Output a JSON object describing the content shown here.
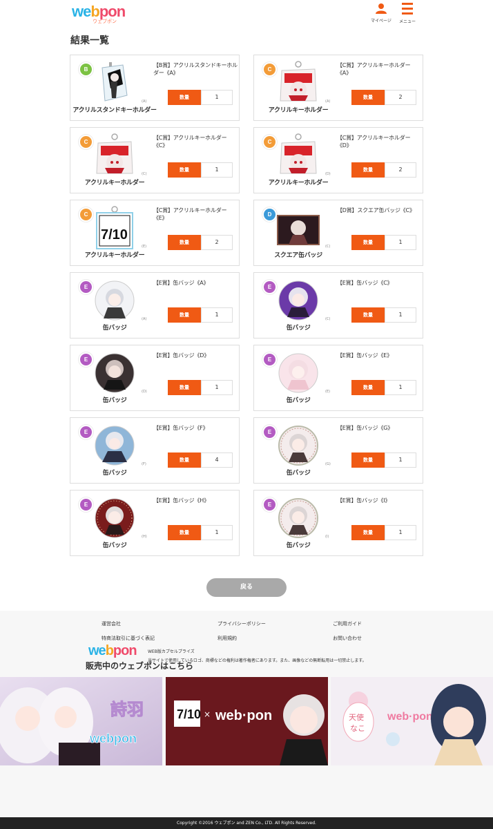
{
  "header": {
    "logo_text": "webpon",
    "logo_kana": "ウェブポン",
    "mypage_label": "マイページ",
    "menu_label": "メニュー"
  },
  "page_title": "結果一覧",
  "qty_label": "数量",
  "items": [
    {
      "rank": "B",
      "rank_color": "#7cc243",
      "type": "acrylic-stand",
      "thumb_label": "アクリルスタンドキーホルダー",
      "variant": "(A)",
      "title": "【B賞】アクリルスタンドキーホルダー《A》",
      "qty": "1"
    },
    {
      "rank": "C",
      "rank_color": "#f39c38",
      "type": "acrylic-key",
      "thumb_label": "アクリルキーホルダー",
      "variant": "(A)",
      "title": "【C賞】アクリルキーホルダー《A》",
      "qty": "2"
    },
    {
      "rank": "C",
      "rank_color": "#f39c38",
      "type": "acrylic-key",
      "thumb_label": "アクリルキーホルダー",
      "variant": "(C)",
      "title": "【C賞】アクリルキーホルダー《C》",
      "qty": "1"
    },
    {
      "rank": "C",
      "rank_color": "#f39c38",
      "type": "acrylic-key",
      "thumb_label": "アクリルキーホルダー",
      "variant": "(D)",
      "title": "【C賞】アクリルキーホルダー《D》",
      "qty": "2"
    },
    {
      "rank": "C",
      "rank_color": "#f39c38",
      "type": "acrylic-logo",
      "thumb_label": "アクリルキーホルダー",
      "variant": "(E)",
      "title": "【C賞】アクリルキーホルダー《E》",
      "qty": "2"
    },
    {
      "rank": "D",
      "rank_color": "#3b9ad9",
      "type": "square-badge",
      "thumb_label": "スクエア缶バッジ",
      "variant": "(C)",
      "title": "【D賞】スクエア缶バッジ《C》",
      "qty": "1"
    },
    {
      "rank": "E",
      "rank_color": "#b35bc2",
      "type": "badge-light",
      "thumb_label": "缶バッジ",
      "variant": "(A)",
      "title": "【E賞】缶バッジ《A》",
      "qty": "1"
    },
    {
      "rank": "E",
      "rank_color": "#b35bc2",
      "type": "badge-purple",
      "thumb_label": "缶バッジ",
      "variant": "(C)",
      "title": "【E賞】缶バッジ《C》",
      "qty": "1"
    },
    {
      "rank": "E",
      "rank_color": "#b35bc2",
      "type": "badge-dark",
      "thumb_label": "缶バッジ",
      "variant": "(D)",
      "title": "【E賞】缶バッジ《D》",
      "qty": "1"
    },
    {
      "rank": "E",
      "rank_color": "#b35bc2",
      "type": "badge-pink",
      "thumb_label": "缶バッジ",
      "variant": "(E)",
      "title": "【E賞】缶バッジ《E》",
      "qty": "1"
    },
    {
      "rank": "E",
      "rank_color": "#b35bc2",
      "type": "badge-blue",
      "thumb_label": "缶バッジ",
      "variant": "(F)",
      "title": "【E賞】缶バッジ《F》",
      "qty": "4"
    },
    {
      "rank": "E",
      "rank_color": "#b35bc2",
      "type": "badge-ring",
      "thumb_label": "缶バッジ",
      "variant": "(G)",
      "title": "【E賞】缶バッジ《G》",
      "qty": "1"
    },
    {
      "rank": "E",
      "rank_color": "#b35bc2",
      "type": "badge-red",
      "thumb_label": "缶バッジ",
      "variant": "(H)",
      "title": "【E賞】缶バッジ《H》",
      "qty": "1"
    },
    {
      "rank": "E",
      "rank_color": "#b35bc2",
      "type": "badge-ring",
      "thumb_label": "缶バッジ",
      "variant": "(I)",
      "title": "【E賞】缶バッジ《I》",
      "qty": "1"
    }
  ],
  "back_label": "戻る",
  "footer": {
    "links": [
      "運営会社",
      "プライバシーポリシー",
      "ご利用ガイド",
      "特商法取引に基づく表記",
      "利用規約",
      "お問い合わせ"
    ],
    "sale_title": "販売中のウェブポンはこちら",
    "note1": "WEB版カプセルプライズ",
    "note2": "当サイトで使用しているロゴ、商標などの権利は著作権者にあります。また、画像などの無断転用は一切禁止します。",
    "copyright": "Copyright ©2016 ウェブポン and ZEN Co., LTD. All Rights Reserved."
  },
  "colors": {
    "accent": "#f05a14",
    "back_button": "#a9a9a9"
  }
}
